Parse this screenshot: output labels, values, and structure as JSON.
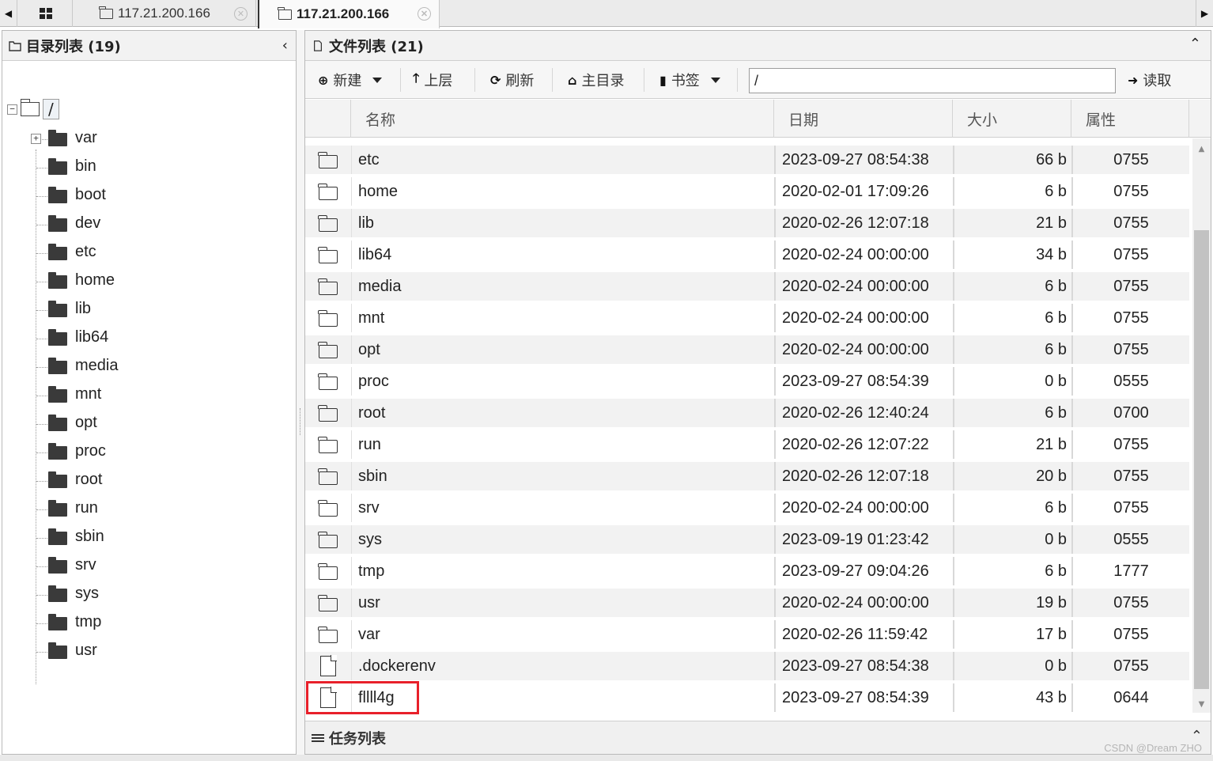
{
  "tabs": [
    {
      "label": "117.21.200.166",
      "active": false
    },
    {
      "label": "117.21.200.166",
      "active": true
    }
  ],
  "icons": {
    "tab_left": "caret-left-icon",
    "tab_right": "caret-right-icon",
    "grid": "grid-icon",
    "close": "close-icon",
    "new": "plus-circle-icon",
    "up": "arrow-up-icon",
    "refresh": "refresh-icon",
    "home": "home-icon",
    "bookmark": "bookmark-icon",
    "read": "arrow-right-icon"
  },
  "left_panel": {
    "title": "目录列表 (19)",
    "collapse_glyph": "‹",
    "root_label": "/",
    "tree": [
      "var",
      "bin",
      "boot",
      "dev",
      "etc",
      "home",
      "lib",
      "lib64",
      "media",
      "mnt",
      "opt",
      "proc",
      "root",
      "run",
      "sbin",
      "srv",
      "sys",
      "tmp",
      "usr"
    ]
  },
  "right_panel": {
    "title": "文件列表 (21)",
    "collapse_glyph": "⌃",
    "toolbar": {
      "new_label": "新建",
      "up_label": "上层",
      "refresh_label": "刷新",
      "home_label": "主目录",
      "bookmark_label": "书签",
      "path_value": "/",
      "read_label": "读取"
    },
    "columns": {
      "name": "名称",
      "date": "日期",
      "size": "大小",
      "attr": "属性"
    },
    "files": [
      {
        "type": "folder",
        "name": "etc",
        "date": "2023-09-27 08:54:38",
        "size": "66 b",
        "attr": "0755"
      },
      {
        "type": "folder",
        "name": "home",
        "date": "2020-02-01 17:09:26",
        "size": "6 b",
        "attr": "0755"
      },
      {
        "type": "folder",
        "name": "lib",
        "date": "2020-02-26 12:07:18",
        "size": "21 b",
        "attr": "0755"
      },
      {
        "type": "folder",
        "name": "lib64",
        "date": "2020-02-24 00:00:00",
        "size": "34 b",
        "attr": "0755"
      },
      {
        "type": "folder",
        "name": "media",
        "date": "2020-02-24 00:00:00",
        "size": "6 b",
        "attr": "0755"
      },
      {
        "type": "folder",
        "name": "mnt",
        "date": "2020-02-24 00:00:00",
        "size": "6 b",
        "attr": "0755"
      },
      {
        "type": "folder",
        "name": "opt",
        "date": "2020-02-24 00:00:00",
        "size": "6 b",
        "attr": "0755"
      },
      {
        "type": "folder",
        "name": "proc",
        "date": "2023-09-27 08:54:39",
        "size": "0 b",
        "attr": "0555"
      },
      {
        "type": "folder",
        "name": "root",
        "date": "2020-02-26 12:40:24",
        "size": "6 b",
        "attr": "0700"
      },
      {
        "type": "folder",
        "name": "run",
        "date": "2020-02-26 12:07:22",
        "size": "21 b",
        "attr": "0755"
      },
      {
        "type": "folder",
        "name": "sbin",
        "date": "2020-02-26 12:07:18",
        "size": "20 b",
        "attr": "0755"
      },
      {
        "type": "folder",
        "name": "srv",
        "date": "2020-02-24 00:00:00",
        "size": "6 b",
        "attr": "0755"
      },
      {
        "type": "folder",
        "name": "sys",
        "date": "2023-09-19 01:23:42",
        "size": "0 b",
        "attr": "0555"
      },
      {
        "type": "folder",
        "name": "tmp",
        "date": "2023-09-27 09:04:26",
        "size": "6 b",
        "attr": "1777"
      },
      {
        "type": "folder",
        "name": "usr",
        "date": "2020-02-24 00:00:00",
        "size": "19 b",
        "attr": "0755"
      },
      {
        "type": "folder",
        "name": "var",
        "date": "2020-02-26 11:59:42",
        "size": "17 b",
        "attr": "0755"
      },
      {
        "type": "file",
        "name": ".dockerenv",
        "date": "2023-09-27 08:54:38",
        "size": "0 b",
        "attr": "0755"
      },
      {
        "type": "file",
        "name": "fllll4g",
        "date": "2023-09-27 08:54:39",
        "size": "43 b",
        "attr": "0644",
        "highlighted": true
      }
    ]
  },
  "task_list": {
    "title": "任务列表",
    "collapse_glyph": "⌃"
  },
  "watermark": "CSDN @Dream ZHO",
  "colors": {
    "highlight": "#e8202a",
    "row_alt": "#f2f2f2"
  }
}
